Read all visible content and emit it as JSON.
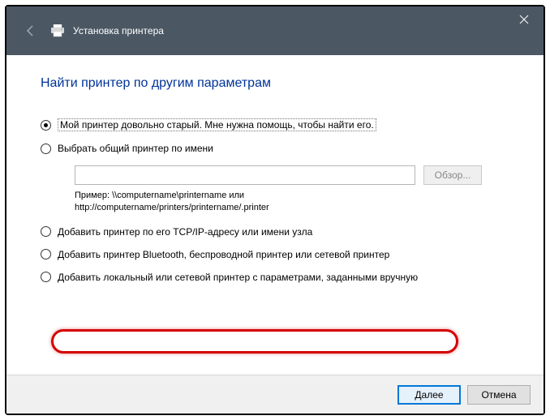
{
  "titlebar": {
    "title": "Установка принтера"
  },
  "content": {
    "heading": "Найти принтер по другим параметрам",
    "options": {
      "old_printer": "Мой принтер довольно старый. Мне нужна помощь, чтобы найти его.",
      "shared_by_name": "Выбрать общий принтер по имени",
      "browse_label": "Обзор...",
      "example_line1": "Пример: \\\\computername\\printername или",
      "example_line2": "http://computername/printers/printername/.printer",
      "tcpip": "Добавить принтер по его TCP/IP-адресу или имени узла",
      "bluetooth": "Добавить принтер Bluetooth, беспроводной принтер или сетевой принтер",
      "local_manual": "Добавить локальный или сетевой принтер с параметрами, заданными вручную"
    }
  },
  "footer": {
    "next": "Далее",
    "cancel": "Отмена"
  }
}
